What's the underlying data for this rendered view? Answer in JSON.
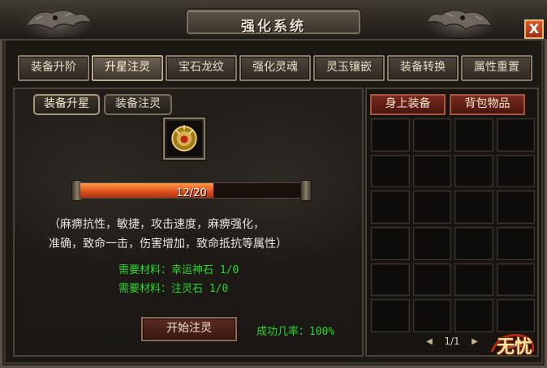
{
  "window": {
    "title": "强化系统",
    "close_label": "X"
  },
  "tabs": [
    {
      "label": "装备升阶"
    },
    {
      "label": "升星注灵"
    },
    {
      "label": "宝石龙纹"
    },
    {
      "label": "强化灵魂"
    },
    {
      "label": "灵玉镶嵌"
    },
    {
      "label": "装备转换"
    },
    {
      "label": "属性重置"
    }
  ],
  "subtabs": [
    {
      "label": "装备升星"
    },
    {
      "label": "装备注灵"
    }
  ],
  "progress": {
    "text": "12/20",
    "current": 12,
    "max": 20
  },
  "attributes": {
    "line1": "（麻痹抗性，敏捷，攻击速度，麻痹强化，",
    "line2": "准确，致命一击，伤害增加，致命抵抗等属性）"
  },
  "materials": [
    {
      "text": "需要材料：幸运神石 1/0"
    },
    {
      "text": "需要材料：注灵石 1/0"
    }
  ],
  "start_button": "开始注灵",
  "success_rate": "成功几率：100%",
  "right_tabs": [
    {
      "label": "身上装备"
    },
    {
      "label": "背包物品"
    }
  ],
  "pager": {
    "text": "1/1"
  },
  "logo_text": "无忧",
  "colors": {
    "accent_green": "#28d82a",
    "progress": "#e0541e",
    "red_tab": "#7a2a1e"
  }
}
